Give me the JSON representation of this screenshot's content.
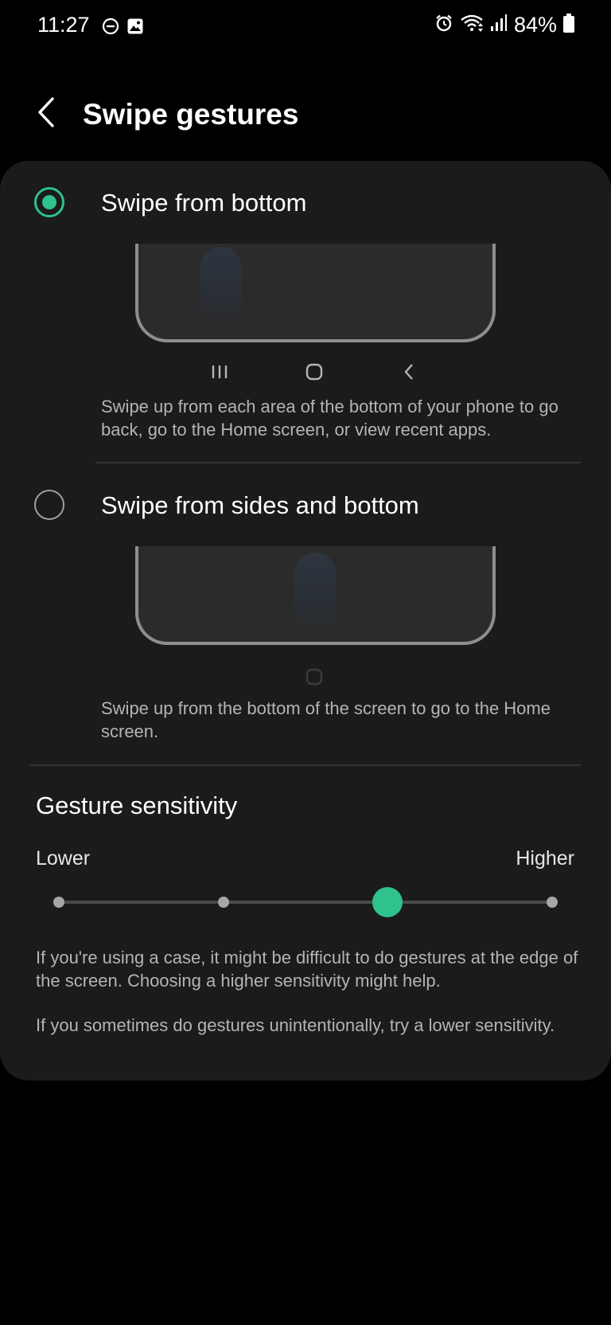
{
  "status_bar": {
    "time": "11:27",
    "battery": "84%",
    "left_icons": [
      "do-not-disturb-icon",
      "gallery-icon"
    ],
    "right_icons": [
      "alarm-icon",
      "wifi-icon",
      "signal-icon",
      "battery-icon"
    ]
  },
  "header": {
    "title": "Swipe gestures"
  },
  "options": [
    {
      "label": "Swipe from bottom",
      "selected": true,
      "description": "Swipe up from each area of the bottom of your phone to go back, go to the Home screen, or view recent apps.",
      "nav_icons": [
        "recent-apps-icon",
        "home-icon",
        "back-icon"
      ]
    },
    {
      "label": "Swipe from sides and bottom",
      "selected": false,
      "description": "Swipe up from the bottom of the screen to go to the Home screen.",
      "nav_icons": [
        "home-icon"
      ]
    }
  ],
  "sensitivity": {
    "title": "Gesture sensitivity",
    "min_label": "Lower",
    "max_label": "Higher",
    "steps": 4,
    "value": 3,
    "help": [
      "If you're using a case, it might be difficult to do gestures at the edge of the screen. Choosing a higher sensitivity might help.",
      "If you sometimes do gestures unintentionally, try a lower sensitivity."
    ]
  },
  "colors": {
    "accent": "#2fc28d",
    "card_background": "#1b1b1b",
    "page_background": "#000000"
  }
}
